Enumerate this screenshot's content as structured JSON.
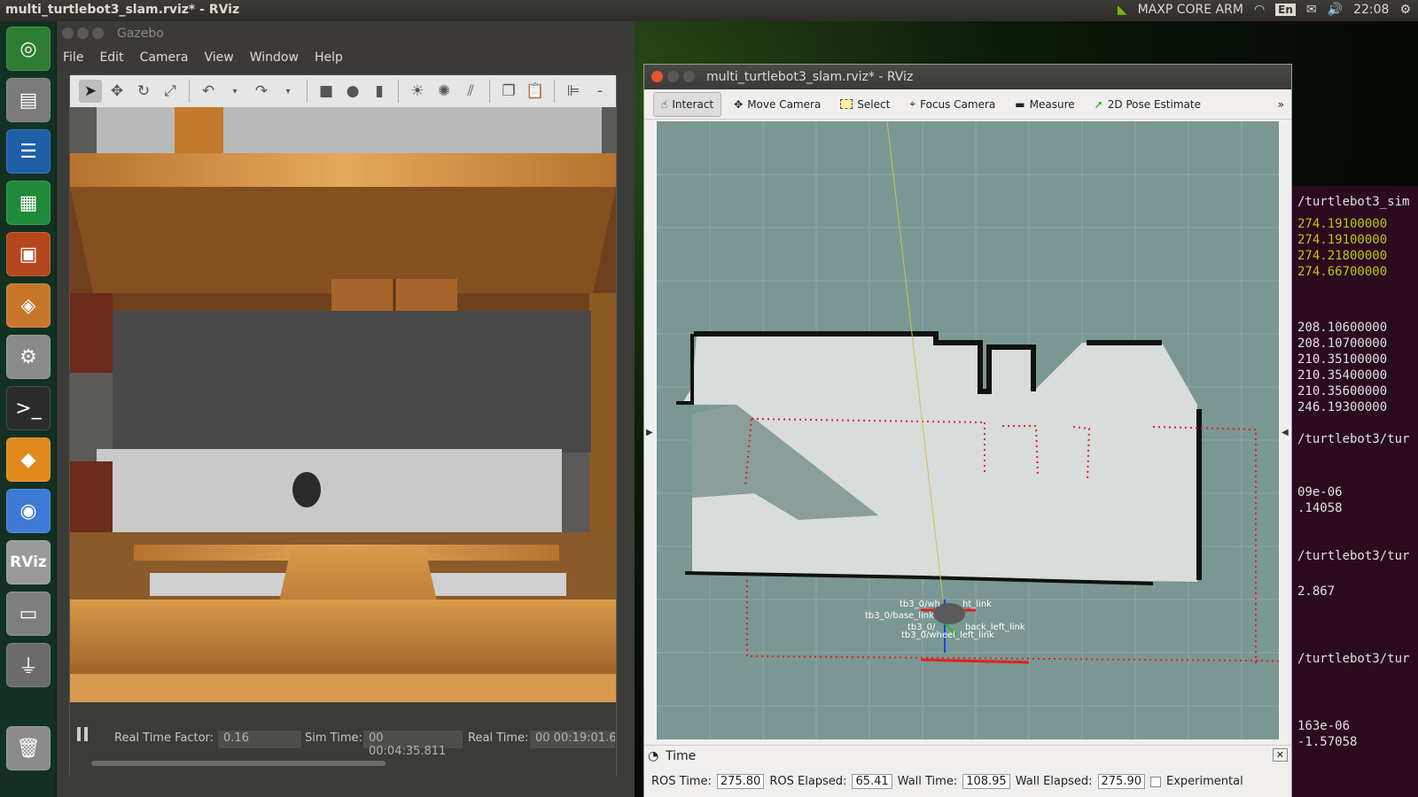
{
  "topbar": {
    "title": "multi_turtlebot3_slam.rviz* - RViz",
    "indicator": "MAXP CORE ARM",
    "lang": "En",
    "time": "22:08"
  },
  "launcher": {
    "items": [
      {
        "name": "ubuntu-dash-icon",
        "color": "#2e7d32"
      },
      {
        "name": "files-icon",
        "color": "#7a7a7a"
      },
      {
        "name": "writer-icon",
        "color": "#1e5fa8"
      },
      {
        "name": "calc-icon",
        "color": "#1f8a3a"
      },
      {
        "name": "impress-icon",
        "color": "#b5461c"
      },
      {
        "name": "software-center-icon",
        "color": "#c7772a"
      },
      {
        "name": "system-settings-icon",
        "color": "#8a8a8a"
      },
      {
        "name": "terminal-icon",
        "color": "#2b2b2b"
      },
      {
        "name": "gazebo-icon",
        "color": "#e08a1e"
      },
      {
        "name": "chromium-icon",
        "color": "#3d7bd6"
      },
      {
        "name": "rviz-icon",
        "color": "#9a9a9a"
      },
      {
        "name": "drive-icon",
        "color": "#7e7e7e"
      },
      {
        "name": "usb-icon",
        "color": "#6b6b6b"
      },
      {
        "name": "trash-icon",
        "color": "#8a8a8a"
      }
    ],
    "rviz_label": "RViz"
  },
  "gazebo": {
    "title": "Gazebo",
    "menu": [
      "File",
      "Edit",
      "Camera",
      "View",
      "Window",
      "Help"
    ],
    "rtf_label": "Real Time Factor:",
    "rtf_value": "0.16",
    "sim_label": "Sim Time:",
    "sim_value": "00 00:04:35.811",
    "real_label": "Real Time:",
    "real_value": "00 00:19:01.6"
  },
  "rviz": {
    "title": "multi_turtlebot3_slam.rviz* - RViz",
    "tools": [
      "Interact",
      "Move Camera",
      "Select",
      "Focus Camera",
      "Measure",
      "2D Pose Estimate"
    ],
    "labels": [
      "tb3_0/wh",
      "ht_link",
      "tb3_0/base_link",
      "tb3_0/wheel_left_link",
      "back_left_link",
      "tb3_0/",
      "tb3_0"
    ],
    "time_panel": "Time",
    "ros_time_label": "ROS Time:",
    "ros_time_value": "275.80",
    "ros_elapsed_label": "ROS Elapsed:",
    "ros_elapsed_value": "65.41",
    "wall_time_label": "Wall Time:",
    "wall_time_value": "108.95",
    "wall_elapsed_label": "Wall Elapsed:",
    "wall_elapsed_value": "275.90",
    "experimental_label": "Experimental"
  },
  "terminal": {
    "lines": [
      {
        "text": "/turtlebot3_sim",
        "style": "w"
      },
      {
        "text": "274.19100000",
        "style": "y"
      },
      {
        "text": "274.19100000",
        "style": "y"
      },
      {
        "text": "274.21800000",
        "style": "y"
      },
      {
        "text": "274.66700000",
        "style": "y"
      },
      {
        "text": "208.10600000",
        "style": "w"
      },
      {
        "text": "208.10700000",
        "style": "w"
      },
      {
        "text": "210.35100000",
        "style": "w"
      },
      {
        "text": "210.35400000",
        "style": "w"
      },
      {
        "text": "210.35600000",
        "style": "w"
      },
      {
        "text": "246.19300000",
        "style": "w"
      },
      {
        "text": "/turtlebot3/tur",
        "style": "w"
      },
      {
        "text": "09e-06",
        "style": "w"
      },
      {
        "text": ".14058",
        "style": "w"
      },
      {
        "text": "/turtlebot3/tur",
        "style": "w"
      },
      {
        "text": "2.867",
        "style": "w"
      },
      {
        "text": "/turtlebot3/tur",
        "style": "w"
      },
      {
        "text": "163e-06",
        "style": "w"
      },
      {
        "text": "-1.57058",
        "style": "w"
      }
    ]
  }
}
